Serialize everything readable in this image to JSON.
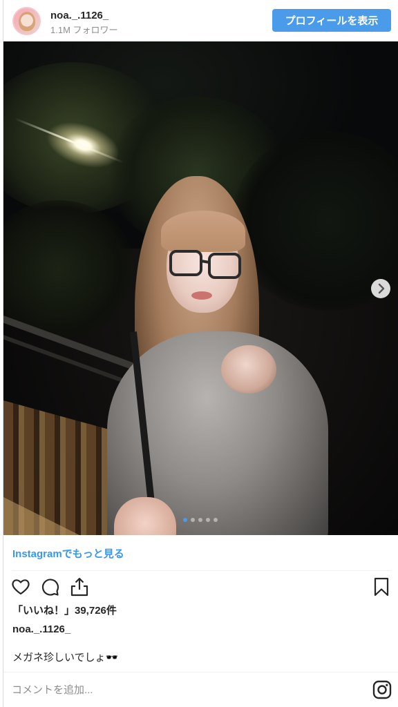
{
  "header": {
    "username": "noa._.1126_",
    "followers": "1.1M フォロワー",
    "profile_button_label": "プロフィールを表示"
  },
  "post": {
    "image_icon": "photo",
    "carousel": {
      "total": 5,
      "current": 1
    },
    "next_icon": "chevron-right-icon"
  },
  "footer": {
    "more_link": "Instagramでもっと見る",
    "actions": {
      "like_icon": "heart-icon",
      "comment_icon": "comment-icon",
      "share_icon": "share-icon",
      "save_icon": "bookmark-icon"
    },
    "likes_text": "「いいね！」39,726件",
    "owner": "noa._.1126_",
    "caption": "メガネ珍しいでしょ🕶️",
    "comment_placeholder": "コメントを追加...",
    "instagram_icon": "instagram-icon"
  },
  "colors": {
    "accent": "#3897f0",
    "button": "#4a9be9",
    "text": "#262626",
    "muted": "#8e8e8e"
  }
}
